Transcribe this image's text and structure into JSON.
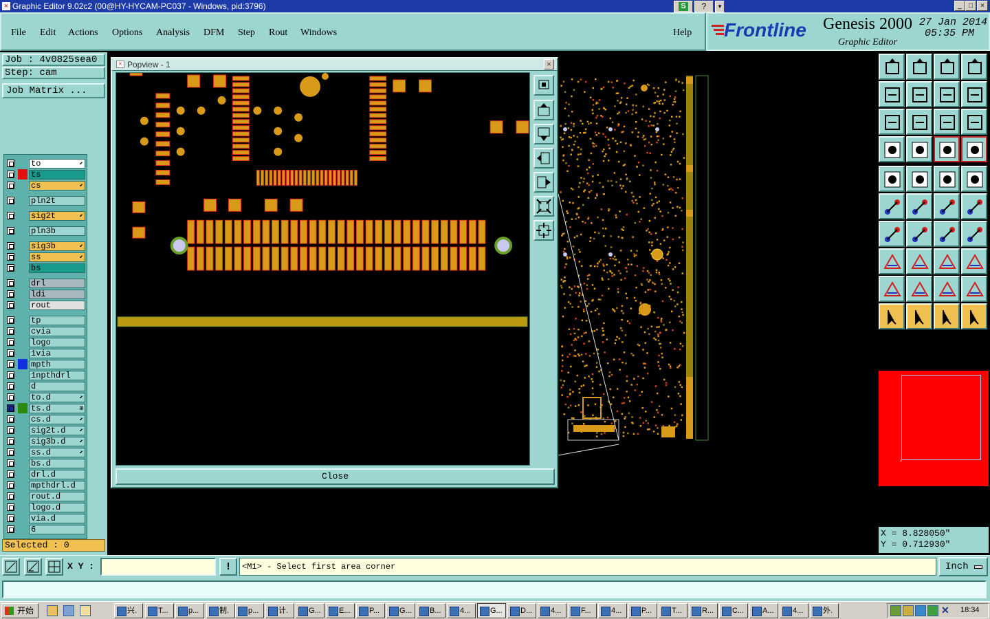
{
  "window": {
    "title": "Graphic Editor 9.02c2 (00@HY-HYCAM-PC037 - Windows, pid:3796)",
    "controls": [
      "_",
      "□",
      "×"
    ]
  },
  "menu": {
    "items": [
      "File",
      "Edit",
      "Actions",
      "Options",
      "Analysis",
      "DFM",
      "Step",
      "Rout",
      "Windows"
    ],
    "help": "Help"
  },
  "brand": {
    "logo": "Frontline",
    "product": "Genesis 2000",
    "subtitle": "Graphic Editor",
    "date": "27 Jan 2014",
    "time": "05:35 PM"
  },
  "job": {
    "job_label": "Job : 4v0825sea0",
    "step_label": "Step: cam",
    "matrix_button": "Job Matrix ...",
    "selected": "Selected : 0"
  },
  "layers": [
    {
      "name": "to",
      "color": "#ffffff",
      "swatch": "",
      "mark": "⬋"
    },
    {
      "name": "ts",
      "color": "#1a9a8a",
      "swatch": "#e01010",
      "mark": ""
    },
    {
      "name": "cs",
      "color": "#f0c050",
      "swatch": "",
      "mark": "⬋"
    },
    {
      "name": "pln2t",
      "color": "#9dd6d0",
      "swatch": "",
      "mark": ""
    },
    {
      "name": "sig2t",
      "color": "#f0c050",
      "swatch": "",
      "mark": "⬋"
    },
    {
      "name": "pln3b",
      "color": "#9dd6d0",
      "swatch": "",
      "mark": ""
    },
    {
      "name": "sig3b",
      "color": "#f0c050",
      "swatch": "",
      "mark": "⬋"
    },
    {
      "name": "ss",
      "color": "#f0c050",
      "swatch": "",
      "mark": "⬋"
    },
    {
      "name": "bs",
      "color": "#1a9a8a",
      "swatch": "",
      "mark": ""
    },
    {
      "name": "drl",
      "color": "#a8b8c0",
      "swatch": "",
      "mark": ""
    },
    {
      "name": "ldi",
      "color": "#a8b8c0",
      "swatch": "",
      "mark": ""
    },
    {
      "name": "rout",
      "color": "#e0e0e0",
      "swatch": "",
      "mark": ""
    },
    {
      "name": "tp",
      "color": "#9dd6d0",
      "swatch": "",
      "mark": ""
    },
    {
      "name": "cvia",
      "color": "#9dd6d0",
      "swatch": "",
      "mark": ""
    },
    {
      "name": "logo",
      "color": "#9dd6d0",
      "swatch": "",
      "mark": ""
    },
    {
      "name": "1via",
      "color": "#9dd6d0",
      "swatch": "",
      "mark": ""
    },
    {
      "name": "mpth",
      "color": "#9dd6d0",
      "swatch": "#1030e0",
      "mark": ""
    },
    {
      "name": "1npthdrl",
      "color": "#9dd6d0",
      "swatch": "",
      "mark": ""
    },
    {
      "name": "d",
      "color": "#9dd6d0",
      "swatch": "",
      "mark": ""
    },
    {
      "name": "to.d",
      "color": "#9dd6d0",
      "swatch": "",
      "mark": "⬋"
    },
    {
      "name": "ts.d",
      "color": "#9dd6d0",
      "swatch": "#2a8a10",
      "mark": "⊞"
    },
    {
      "name": "cs.d",
      "color": "#9dd6d0",
      "swatch": "",
      "mark": "⬋"
    },
    {
      "name": "sig2t.d",
      "color": "#9dd6d0",
      "swatch": "",
      "mark": "⬋"
    },
    {
      "name": "sig3b.d",
      "color": "#9dd6d0",
      "swatch": "",
      "mark": "⬋"
    },
    {
      "name": "ss.d",
      "color": "#9dd6d0",
      "swatch": "",
      "mark": "⬋"
    },
    {
      "name": "bs.d",
      "color": "#9dd6d0",
      "swatch": "",
      "mark": ""
    },
    {
      "name": "drl.d",
      "color": "#9dd6d0",
      "swatch": "",
      "mark": ""
    },
    {
      "name": "mpthdrl.d",
      "color": "#9dd6d0",
      "swatch": "",
      "mark": ""
    },
    {
      "name": "rout.d",
      "color": "#9dd6d0",
      "swatch": "",
      "mark": ""
    },
    {
      "name": "logo.d",
      "color": "#9dd6d0",
      "swatch": "",
      "mark": ""
    },
    {
      "name": "via.d",
      "color": "#9dd6d0",
      "swatch": "",
      "mark": ""
    },
    {
      "name": "6",
      "color": "#9dd6d0",
      "swatch": "",
      "mark": ""
    }
  ],
  "popview": {
    "title": "Popview - 1",
    "close_button": "Close"
  },
  "coords": {
    "x": "X = 8.828050\"",
    "y": "Y = 0.712930\""
  },
  "status": {
    "xy_label": "X Y :",
    "xy_value": "",
    "message": "<M1> - Select first area corner",
    "units": "Inch",
    "excl": "!"
  },
  "taskbar": {
    "start": "开始",
    "tasks": [
      "兴.",
      "T...",
      "p...",
      "制.",
      "p...",
      "计.",
      "G...",
      "E...",
      "P...",
      "G...",
      "B...",
      "4...",
      "G...",
      "D...",
      "4...",
      "F...",
      "4...",
      "P...",
      "T...",
      "R...",
      "C...",
      "A...",
      "4...",
      "外."
    ],
    "clock": "18:34"
  },
  "colors": {
    "panel": "#9dd6d0",
    "pad": "#d89a18",
    "pad_edge": "#e03020",
    "via_ring": "#6aa02a",
    "via_hole": "#c8c8f0",
    "trace": "#b99a10",
    "red_area": "#ff0000"
  }
}
